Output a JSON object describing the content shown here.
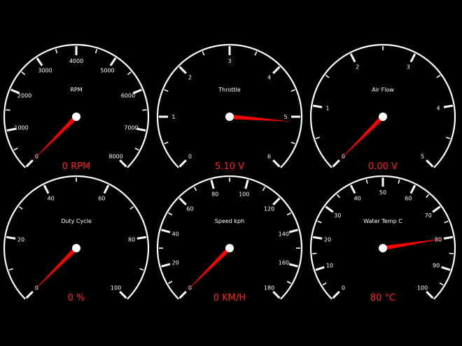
{
  "theme": {
    "background": "#000000",
    "dial": "#ffffff",
    "needle": "#ff0000",
    "readout": "#ff2222"
  },
  "gauges": [
    {
      "id": "rpm",
      "title": "RPM",
      "labels": [
        "0",
        "1000",
        "2000",
        "3000",
        "4000",
        "5000",
        "6000",
        "7000",
        "8000"
      ],
      "min": 0,
      "max": 8000,
      "value": 0,
      "readout": "0 RPM"
    },
    {
      "id": "throttle",
      "title": "Throttle",
      "labels": [
        "0",
        "1",
        "2",
        "3",
        "4",
        "5",
        "6"
      ],
      "min": 0,
      "max": 6,
      "value": 5.1,
      "readout": "5.10 V"
    },
    {
      "id": "air-flow",
      "title": "Air Flow",
      "labels": [
        "0",
        "1",
        "2",
        "3",
        "4",
        "5"
      ],
      "min": 0,
      "max": 5,
      "value": 0,
      "readout": "0.00 V"
    },
    {
      "id": "duty-cycle",
      "title": "Duty Cycle",
      "labels": [
        "0",
        "20",
        "40",
        "60",
        "80",
        "100"
      ],
      "min": 0,
      "max": 100,
      "value": 0,
      "readout": "0 %"
    },
    {
      "id": "speed",
      "title": "Speed kph",
      "labels": [
        "0",
        "20",
        "40",
        "60",
        "80",
        "100",
        "120",
        "140",
        "160",
        "180"
      ],
      "min": 0,
      "max": 180,
      "value": 0,
      "readout": "0 KM/H"
    },
    {
      "id": "water-temp",
      "title": "Water Temp C",
      "labels": [
        "0",
        "10",
        "20",
        "30",
        "40",
        "50",
        "60",
        "70",
        "80",
        "90",
        "100"
      ],
      "min": 0,
      "max": 100,
      "value": 80,
      "readout": "80 °C"
    }
  ]
}
